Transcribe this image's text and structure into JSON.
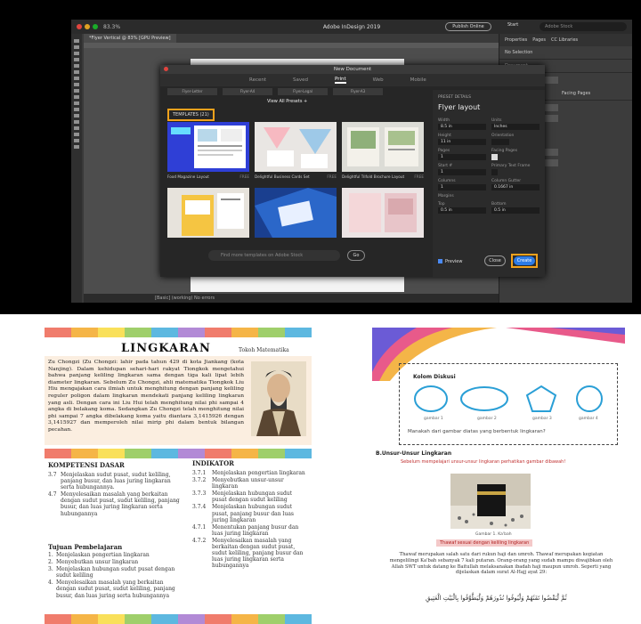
{
  "top_screenshot": {
    "window_title": "Adobe InDesign 2019",
    "zoom": "83.3%",
    "doc_tab": "*Flyer Vertical @ 83% [GPU Preview]",
    "publish_button": "Publish Online",
    "workspace": "Start",
    "stock_search_placeholder": "Adobe Stock",
    "right_panel": {
      "tabs": [
        "Properties",
        "Pages",
        "CC Libraries"
      ],
      "sections": [
        "No Selection",
        "Document"
      ],
      "facing_pages": "Facing Pages"
    },
    "statusbar": "[Basic] (working)   No errors",
    "dialog": {
      "title": "New Document",
      "tabs": [
        "Recent",
        "Saved",
        "Print",
        "Web",
        "Mobile"
      ],
      "active_tab": "Print",
      "blank_presets": [
        "Flyer-Letter",
        "Flyer-A4",
        "Flyer-Legal",
        "Flyer-A3"
      ],
      "view_all": "View All Presets  +",
      "templates_header": "TEMPLATES (21)",
      "templates": [
        {
          "name": "Food Magazine Layout",
          "tag": "FREE"
        },
        {
          "name": "Delightful Business Cards Set",
          "tag": "FREE"
        },
        {
          "name": "Delightful Trifold Brochure Layout",
          "tag": "FREE"
        },
        {
          "name": "",
          "tag": ""
        },
        {
          "name": "",
          "tag": ""
        },
        {
          "name": "",
          "tag": ""
        }
      ],
      "find_placeholder": "Find more templates on Adobe Stock",
      "go_button": "Go",
      "preset_details": {
        "header": "PRESET DETAILS",
        "name": "Flyer layout",
        "width_label": "Width",
        "width": "8.5 in",
        "units_label": "Units",
        "units": "Inches",
        "height_label": "Height",
        "height": "11 in",
        "orientation_label": "Orientation",
        "pages_label": "Pages",
        "pages": "1",
        "facing_label": "Facing Pages",
        "start_label": "Start #",
        "start": "1",
        "primary_label": "Primary Text Frame",
        "columns_label": "Columns",
        "columns": "1",
        "gutter_label": "Column Gutter",
        "gutter": "0.1667 in",
        "margins_label": "Margins",
        "top_label": "Top",
        "top": "0.5 in",
        "bottom_label": "Bottom",
        "bottom": "0.5 in"
      },
      "preview_label": "Preview",
      "close_button": "Close",
      "create_button": "Create"
    }
  },
  "left_page": {
    "title": "LINGKARAN",
    "tokoh": "Tokoh Matematika",
    "intro": "Zu Chongzi (Zu Chongzi: lahir pada tahun 429 di kota Jiankang (kota Nanjing). Dalam kehidupan sehari-hari rakyat Tiongkok mengetahui bahwa panjang keliling lingkaran sama dengan tiga kali lipat lebih diameter lingkaran. Sebelum Zu Chongzi, ahli matematika Tiongkok Liu Hiu mengajakan cara ilmiah untuk menghitung dengan panjang keliling reguler poligon dalam lingkaran mendekati panjang keliling lingkaran yang asli. Dengan cara ini Liu Hui telah menghitung nilai phi sampai 4 angka di belakang koma. Sedangkan Zu Chongzi telah menghitung nilai phi sampai 7 angka dibelakang koma yaitu diantara 3,1415926 dengan 3,1415927 dan memperoleh nilai mirip phi dalam bentuk bilangan pecahan.",
    "kd_title": "KOMPETENSI DASAR",
    "kd": [
      {
        "n": "3.7",
        "t": "Menjelaskan sudut pusat, sudut keliling, panjang busur, dan luas juring lingkaran serta hubungannya."
      },
      {
        "n": "4.7",
        "t": "Menyelesaikan masalah yang berkaitan dengan sudut pusat, sudut keliling, panjang busur, dan luas juring lingkaran serta hubungannya"
      }
    ],
    "ind_title": "INDIKATOR",
    "ind": [
      {
        "n": "3.7.1",
        "t": "Menjelaskan pengertian lingkaran"
      },
      {
        "n": "3.7.2",
        "t": "Menyebutkan unsur-unsur lingkaran"
      },
      {
        "n": "3.7.3",
        "t": "Menjelaskan hubungan sudut pusat dengan sudut keliling"
      },
      {
        "n": "3.7.4",
        "t": "Menjelaskan hubungan sudut pusat, panjang busur dan luas juring lingkaran"
      },
      {
        "n": "4.7.1",
        "t": "Menentukan panjang busur dan luas juring lingkaran"
      },
      {
        "n": "4.7.2",
        "t": "Menyelesaikan masalah yang berkaitan dengan sudut pusat, sudut keliling, panjang busur dan luas juring lingkaran serta hubungannya"
      }
    ],
    "tp_title": "Tujuan Pembelajaran",
    "tp": [
      {
        "n": "1.",
        "t": "Menjelaskan pengertian lingkaran"
      },
      {
        "n": "2.",
        "t": "Menyebutkan unsur lingkaran"
      },
      {
        "n": "3.",
        "t": "Menjelaskan hubungan sudut pusat dengan sudut keliling"
      },
      {
        "n": "4.",
        "t": "Menyelesaikan masalah yang berkaitan dengan sudut pusat, sudut keliling, panjang busur, dan luas juring serta hubungannya"
      }
    ]
  },
  "right_page": {
    "box_title": "Kolom Diskusi",
    "shape_caps": [
      "gambar 1",
      "gambar 2",
      "gambar 3",
      "gambar 4"
    ],
    "question": "Manakah dari gambar diatas yang berbentuk lingkaran?",
    "section": "B.Unsur-Unsur Lingkaran",
    "section_sub": "Sebelum mempelajari unsur-unsur lingkaran perhatikan gambar dibawah!",
    "image_caption": "Gambar 1. Ka'bah",
    "highlight": "Thawaf sesuai dengan keliling lingkaran",
    "paragraph": "Thawaf merupakan salah satu dari rukun haji dan umroh. Thawaf merupakan kegiatan mengelilingi Ka'bah sebanyak 7 kali putaran. Orang-orang yang sudah mampu diwajibkan oleh Allah SWT untuk datang ke Baitullah melaksanakan ibadah haji maupun umroh. Seperti yang dijelaskan dalam surat Al-Hajj ayat 29:",
    "arabic": "ثُمَّ لْيَقْضُوا تَفَثَهُمْ وَلْيُوفُوا نُذُورَهُمْ وَلْيَطَّوَّفُوا بِالْبَيْتِ الْعَتِيقِ"
  }
}
